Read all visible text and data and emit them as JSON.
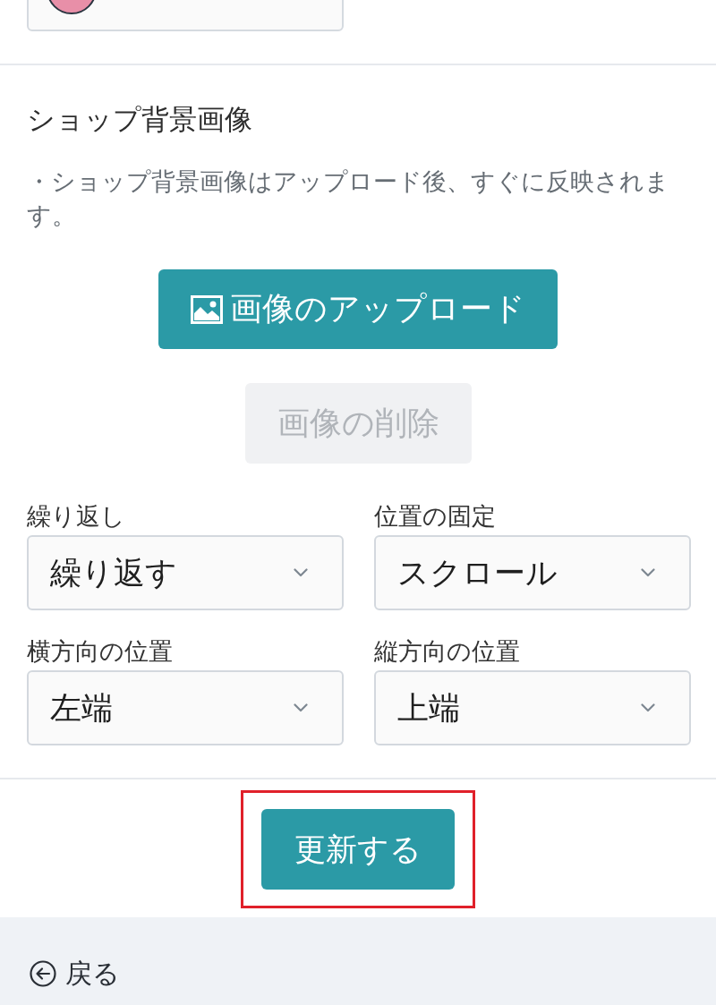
{
  "background_image": {
    "title": "ショップ背景画像",
    "note": "・ショップ背景画像はアップロード後、すぐに反映されます。",
    "upload_button": {
      "label": "画像のアップロード"
    },
    "delete_button": {
      "label": "画像の削除",
      "disabled": true
    },
    "selects": [
      {
        "label": "繰り返し",
        "value": "繰り返す"
      },
      {
        "label": "位置の固定",
        "value": "スクロール"
      },
      {
        "label": "横方向の位置",
        "value": "左端"
      },
      {
        "label": "縦方向の位置",
        "value": "上端"
      }
    ]
  },
  "submit_button": {
    "label": "更新する",
    "highlighted": true
  },
  "footer": {
    "back_link": "戻る"
  }
}
